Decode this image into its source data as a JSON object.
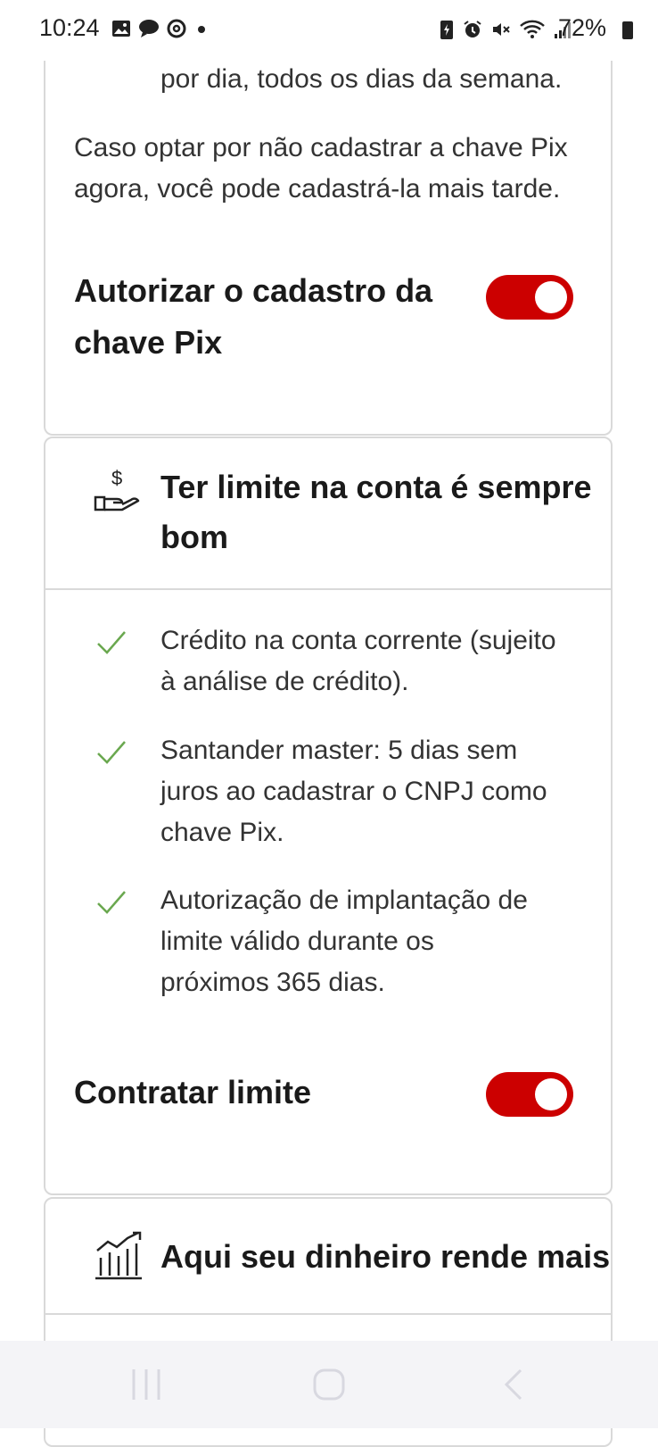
{
  "status_bar": {
    "time": "10:24",
    "battery": "72%",
    "left_icons": [
      "gallery-icon",
      "chat-icon",
      "threads-icon",
      "dot-icon"
    ],
    "right_icons": [
      "battery-saver-icon",
      "alarm-icon",
      "mute-icon",
      "wifi-icon",
      "signal-icon"
    ]
  },
  "pix_card": {
    "partial_text": "por dia, todos os dias da semana.",
    "info_line1": "Caso optar por não cadastrar a chave Pix",
    "info_line2": "agora, você pode cadastrá-la mais tarde.",
    "toggle_label_line1": "Autorizar o cadastro da",
    "toggle_label_line2": "chave Pix",
    "toggle_on": true
  },
  "limit_card": {
    "title_line1": "Ter limite na conta é sempre",
    "title_line2": "bom",
    "items": [
      {
        "lines": [
          "Crédito na conta corrente (sujeito",
          "à análise de crédito)."
        ]
      },
      {
        "lines": [
          "Santander master: 5 dias sem",
          "juros ao cadastrar o CNPJ como",
          "chave Pix."
        ]
      },
      {
        "lines": [
          "Autorização de implantação de",
          "limite válido durante os",
          "próximos 365 dias."
        ]
      }
    ],
    "toggle_label": "Contratar limite",
    "toggle_on": true
  },
  "invest_card": {
    "title": "Aqui seu dinheiro rende mais"
  },
  "colors": {
    "accent": "#cc0000",
    "check": "#6aa84f",
    "border": "#d9d9d9"
  }
}
